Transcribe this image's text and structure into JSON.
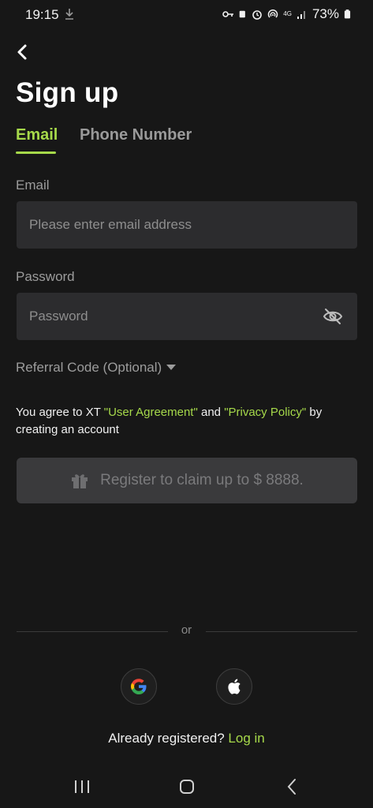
{
  "status_bar": {
    "time": "19:15",
    "battery": "73%",
    "network": "4G"
  },
  "header": {
    "title": "Sign up"
  },
  "tabs": [
    {
      "label": "Email",
      "active": true
    },
    {
      "label": "Phone Number",
      "active": false
    }
  ],
  "form": {
    "email_label": "Email",
    "email_placeholder": "Please enter email address",
    "password_label": "Password",
    "password_placeholder": "Password",
    "referral_label": "Referral Code (Optional)"
  },
  "agreement": {
    "prefix": "You agree to XT ",
    "user_agreement": "\"User Agreement\"",
    "middle": " and ",
    "privacy_policy": "\"Privacy Policy\"",
    "suffix": " by creating an account"
  },
  "register_button": {
    "label": "Register to claim up to $ 8888."
  },
  "divider_text": "or",
  "login": {
    "prompt": "Already registered? ",
    "link": "Log in"
  },
  "colors": {
    "accent": "#a6d94a",
    "background": "#171717",
    "input_bg": "#2c2c2e",
    "button_bg": "#3a3a3c"
  },
  "icons": [
    "back-arrow-icon",
    "eye-off-icon",
    "caret-down-icon",
    "gift-icon",
    "google-icon",
    "apple-icon"
  ]
}
